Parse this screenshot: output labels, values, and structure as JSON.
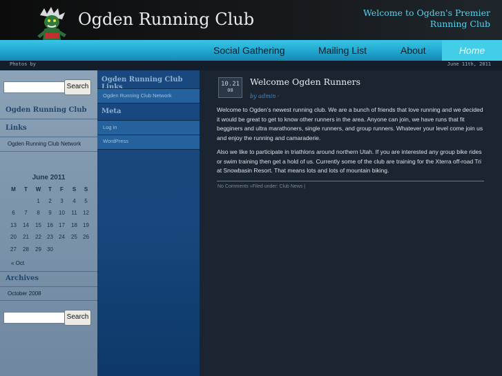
{
  "header": {
    "site_title": "Ogden Running Club",
    "tagline": "Welcome to Ogden's Premier Running Club"
  },
  "nav": {
    "items": [
      {
        "label": "Social Gathering"
      },
      {
        "label": "Mailing List"
      },
      {
        "label": "About"
      },
      {
        "label": "Home",
        "active": true
      }
    ]
  },
  "subbar": {
    "photos_label": "Photos by",
    "date": "June 11th, 2011"
  },
  "left_sidebar": {
    "search_button": "Search",
    "blog_heading_line1": "Ogden Running Club",
    "blog_heading_line2": "Links",
    "links": [
      "Ogden Running Club Network"
    ],
    "calendar": {
      "title": "June 2011",
      "weekdays": [
        "M",
        "T",
        "W",
        "T",
        "F",
        "S",
        "S"
      ],
      "weeks": [
        [
          "",
          "",
          "1",
          "2",
          "3",
          "4",
          "5"
        ],
        [
          "6",
          "7",
          "8",
          "9",
          "10",
          "11",
          "12"
        ],
        [
          "13",
          "14",
          "15",
          "16",
          "17",
          "18",
          "19"
        ],
        [
          "20",
          "21",
          "22",
          "23",
          "24",
          "25",
          "26"
        ],
        [
          "27",
          "28",
          "29",
          "30",
          "",
          "",
          ""
        ]
      ],
      "prev_link": "« Oct"
    },
    "archives_heading": "Archives",
    "archives": [
      "October 2008"
    ],
    "search_button_2": "Search"
  },
  "mid_sidebar": {
    "links_heading": "Ogden Running Club Links",
    "links": [
      "Ogden Running Club Network"
    ],
    "meta_heading": "Meta",
    "meta_links": [
      "Log in",
      "WordPress"
    ]
  },
  "post": {
    "date_day": "10.21",
    "date_year": "08",
    "title": "Welcome Ogden Runners",
    "meta": "by admin ·",
    "paragraphs": [
      "Welcome to Ogden’s newest running club.  We are a  bunch of friends that love running and we decided it would be great to get to know other runners in the area.   Anyone can join, we have runs that fit begginers and ultra marathoners, single runners, and group runners.  Whatever your level come join us and enjoy the running and camaraderie.",
      "Also we like to participate in triathlons around northern Utah.   If you are interested any group bike rides or swim training then get a hold of us.  Currently some of the club are training for the Xterra off-road Tri at Snowbasin Resort.  That means lots and lots of mountain biking."
    ],
    "footer": "No Comments »Filed under: Club News |"
  },
  "colors": {
    "nav_bar": "#21a6cf",
    "tagline": "#55d2ee",
    "left_sidebar": "#7e96ac",
    "mid_sidebar": "#17477e",
    "main_bg": "#1b2431"
  }
}
